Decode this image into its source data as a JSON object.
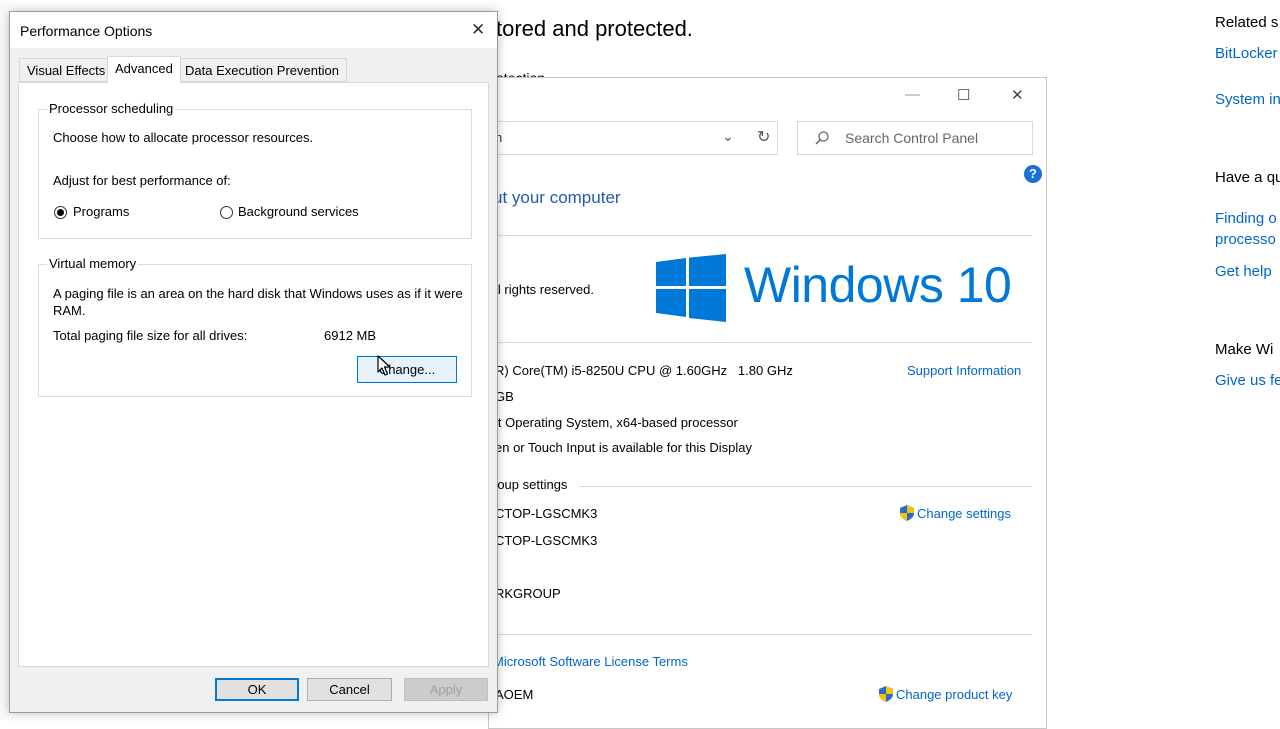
{
  "settings_bg": {
    "title": "tored and protected.",
    "subtitle_fragment": "otection"
  },
  "related": {
    "heading": "Related s",
    "bitlocker": "BitLocker",
    "system_info": "System in",
    "have_question": "Have a qu",
    "finding": "Finding o",
    "processor": "processo",
    "get_help": "Get help",
    "make_windows": "Make Wi",
    "give_feedback": "Give us fe"
  },
  "system_window": {
    "window_controls": {
      "minimize": "—",
      "maximize": "☐",
      "close": "✕"
    },
    "address_text": "n",
    "search_placeholder": "Search Control Panel",
    "heading": "ut your computer",
    "copyright": "ll rights reserved.",
    "windows_logo_text": "Windows 10",
    "processor_text": "R) Core(TM) i5-8250U CPU @ 1.60GHz   1.80 GHz",
    "ram_text": "GB",
    "system_type": "it Operating System, x64-based processor",
    "pen_touch": "en or Touch Input is available for this Display",
    "support_info": "Support Information",
    "workgroup_section": "roup settings",
    "computer_name": "CTOP-LGSCMK3",
    "full_name": "CTOP-LGSCMK3",
    "workgroup": "RKGROUP",
    "change_settings": "Change settings",
    "license_terms": "Microsoft Software License Terms",
    "product_id": "AOEM",
    "change_product_key": "Change product key"
  },
  "dialog": {
    "title": "Performance Options",
    "close": "✕",
    "tabs": [
      "Visual Effects",
      "Advanced",
      "Data Execution Prevention"
    ],
    "selected_tab": "Advanced",
    "processor_group": {
      "label": "Processor scheduling",
      "desc": "Choose how to allocate processor resources.",
      "adjust": "Adjust for best performance of:",
      "opt_programs": "Programs",
      "opt_background": "Background services",
      "selected": "Programs"
    },
    "vm_group": {
      "label": "Virtual memory",
      "desc": "A paging file is an area on the hard disk that Windows uses as if it were RAM.",
      "total_label": "Total paging file size for all drives:",
      "total_value": "6912 MB",
      "change_button": "Change..."
    },
    "buttons": {
      "ok": "OK",
      "cancel": "Cancel",
      "apply": "Apply"
    }
  },
  "colors": {
    "accent": "#0078d7",
    "link": "#0066cc",
    "windows_blue": "#0078d7"
  }
}
